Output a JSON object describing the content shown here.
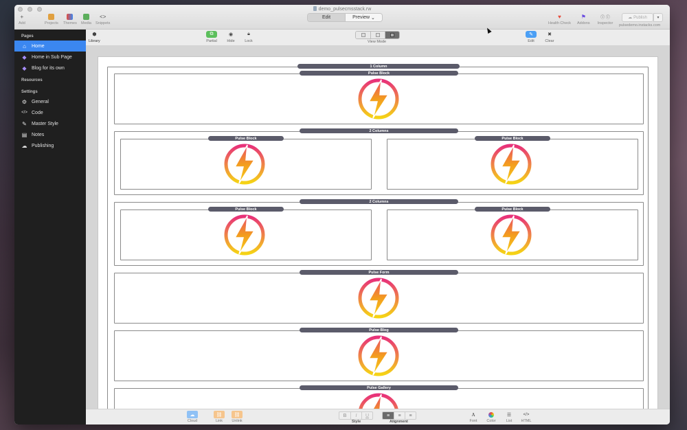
{
  "window": {
    "title": "demo_pulsecmsstack.rw",
    "site_url": "pulsedemo.instacks.com"
  },
  "toolbar": {
    "add": "Add",
    "projects": "Projects",
    "themes": "Themes",
    "media": "Media",
    "snippets": "Snippets",
    "edit": "Edit",
    "preview": "Preview",
    "health_check": "Health Check",
    "addons": "Addons",
    "inspector": "Inspector",
    "publish": "Publish"
  },
  "sidebar": {
    "pages_header": "Pages",
    "pages": [
      {
        "label": "Home",
        "icon": "home-icon",
        "active": true
      },
      {
        "label": "Home in Sub Page",
        "icon": "stack-page-icon"
      },
      {
        "label": "Blog for its own",
        "icon": "stack-page-icon"
      }
    ],
    "resources_header": "Resources",
    "settings_header": "Settings",
    "settings": [
      {
        "label": "General",
        "icon": "gear-icon"
      },
      {
        "label": "Code",
        "icon": "code-icon"
      },
      {
        "label": "Master Style",
        "icon": "brush-icon"
      },
      {
        "label": "Notes",
        "icon": "notes-icon"
      },
      {
        "label": "Publishing",
        "icon": "cloud-icon"
      }
    ]
  },
  "subbar": {
    "library": "Library",
    "partial": "Partial",
    "hide": "Hide",
    "lock": "Lock",
    "view_mode": "View Mode",
    "edit": "Edit",
    "clear": "Clear"
  },
  "stacks": {
    "one_column": "1 Column",
    "pulse_block": "Pulse Block",
    "two_columns": "2 Columns",
    "pulse_form": "Pulse Form",
    "pulse_blog": "Pulse Blog",
    "pulse_gallery": "Pulse Gallery"
  },
  "bottombar": {
    "cloud": "Cloud",
    "link": "Link",
    "unlink": "Unlink",
    "bold": "B",
    "italic": "I",
    "underline": "U",
    "style": "Style",
    "alignment": "Alignment",
    "font": "Font",
    "color": "Color",
    "list": "List",
    "html": "HTML"
  },
  "colors": {
    "accent": "#3b87f0",
    "tag": "#5b5b6a",
    "bolt_ring_top": "#e8317a",
    "bolt_ring_bottom": "#f5d415",
    "bolt_fill": "#f39c1e"
  }
}
